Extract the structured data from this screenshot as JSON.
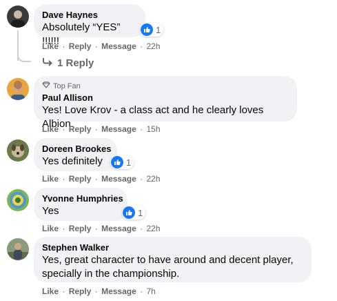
{
  "actions": {
    "like": "Like",
    "reply": "Reply",
    "message": "Message",
    "sep": "·"
  },
  "comments": [
    {
      "author": "Dave Haynes",
      "text": "Absolutely “YES” !!!!!!",
      "time": "22h",
      "reactions": "1",
      "avatar_icon": "avatar-man-dark"
    },
    {
      "badge": "Top Fan",
      "author": "Paul Allison",
      "text": "Yes! Love Krov - a class act and he clearly loves Albion.",
      "time": "15h",
      "avatar_icon": "avatar-man-orange"
    },
    {
      "author": "Doreen Brookes",
      "text": "Yes definitely",
      "time": "22h",
      "reactions": "1",
      "avatar_icon": "avatar-dog"
    },
    {
      "author": "Yvonne Humphries",
      "text": "Yes",
      "time": "22h",
      "reactions": "1",
      "avatar_icon": "avatar-green-badge"
    },
    {
      "author": "Stephen Walker",
      "text_line1": "Yes, great character to have around and decent player,",
      "text_line2": "specially in the championship.",
      "time": "7h",
      "avatar_icon": "avatar-man-outdoor"
    }
  ],
  "replies_link": "1 Reply",
  "colors": {
    "bubble": "#f0f2f5",
    "like_blue": "#1877f2",
    "meta_gray": "#65676b"
  }
}
